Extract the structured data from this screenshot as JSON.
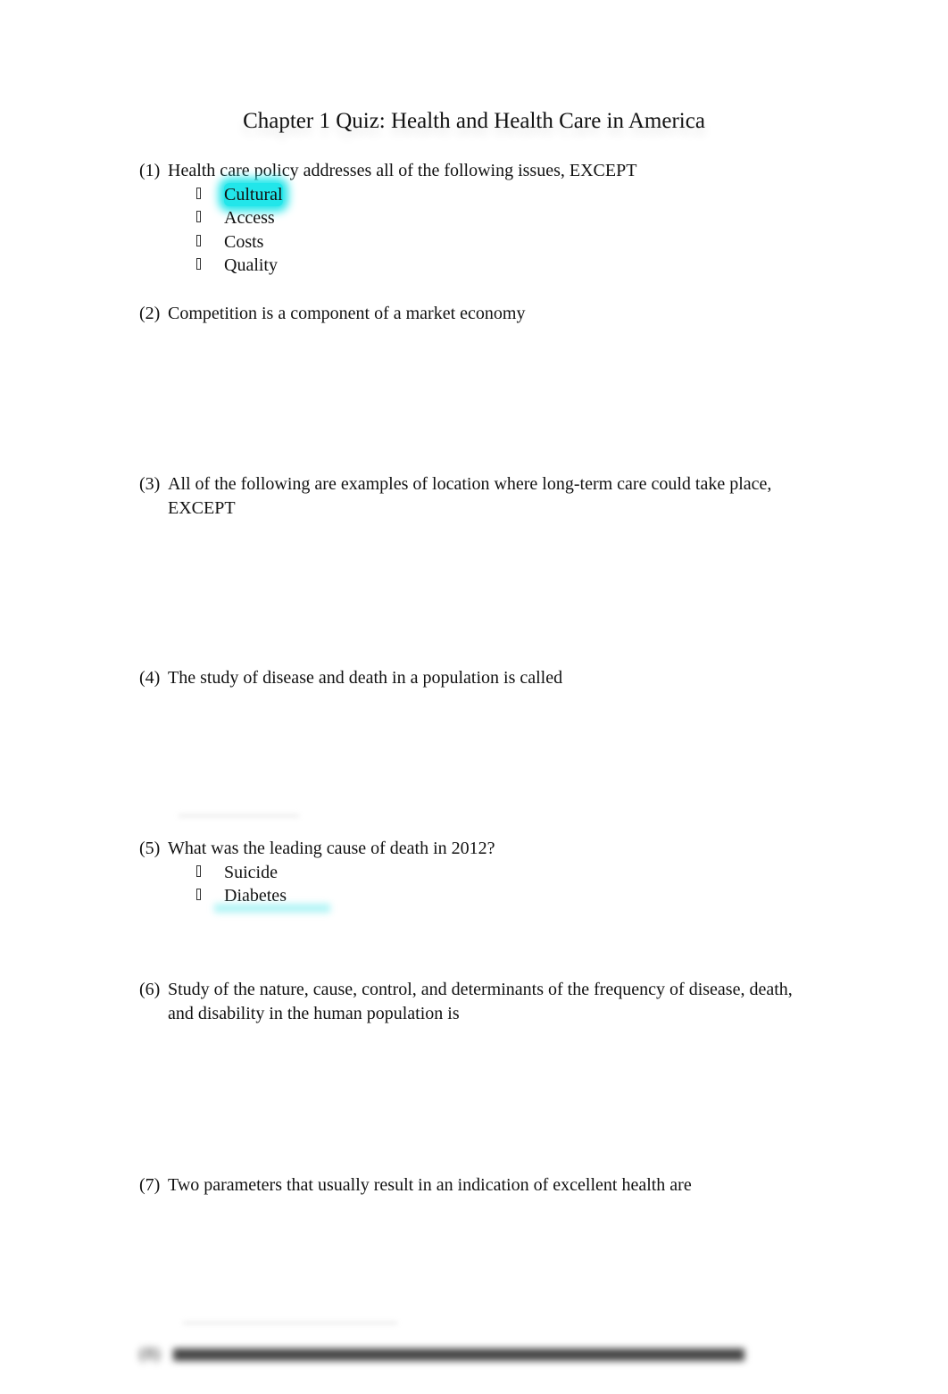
{
  "document": {
    "title": "Chapter 1 Quiz: Health and Health Care in America",
    "questions": [
      {
        "number": "(1)",
        "text": "Health care policy addresses all of the following issues, EXCEPT",
        "options": [
          {
            "label": "Cultural",
            "highlighted": true
          },
          {
            "label": "Access",
            "highlighted": false
          },
          {
            "label": "Costs",
            "highlighted": false
          },
          {
            "label": "Quality",
            "highlighted": false
          }
        ]
      },
      {
        "number": "(2)",
        "text": "Competition is a component of a market economy"
      },
      {
        "number": "(3)",
        "text": "All of the following are examples of location where long-term care could take place, EXCEPT"
      },
      {
        "number": "(4)",
        "text": "The study of disease and death in a population is called"
      },
      {
        "number": "(5)",
        "text": "What was the leading cause of death in 2012?",
        "options": [
          {
            "label": "Suicide",
            "highlighted": false
          },
          {
            "label": "Diabetes",
            "highlighted": false
          }
        ]
      },
      {
        "number": "(6)",
        "text": "Study of the nature, cause, control, and determinants of the frequency of disease, death, and disability in the human population is"
      },
      {
        "number": "(7)",
        "text": "Two parameters that usually result in an indication of excellent health are"
      },
      {
        "number": "(8)",
        "text": "",
        "blurred": true
      }
    ],
    "highlight_color": "#22e6ea"
  }
}
